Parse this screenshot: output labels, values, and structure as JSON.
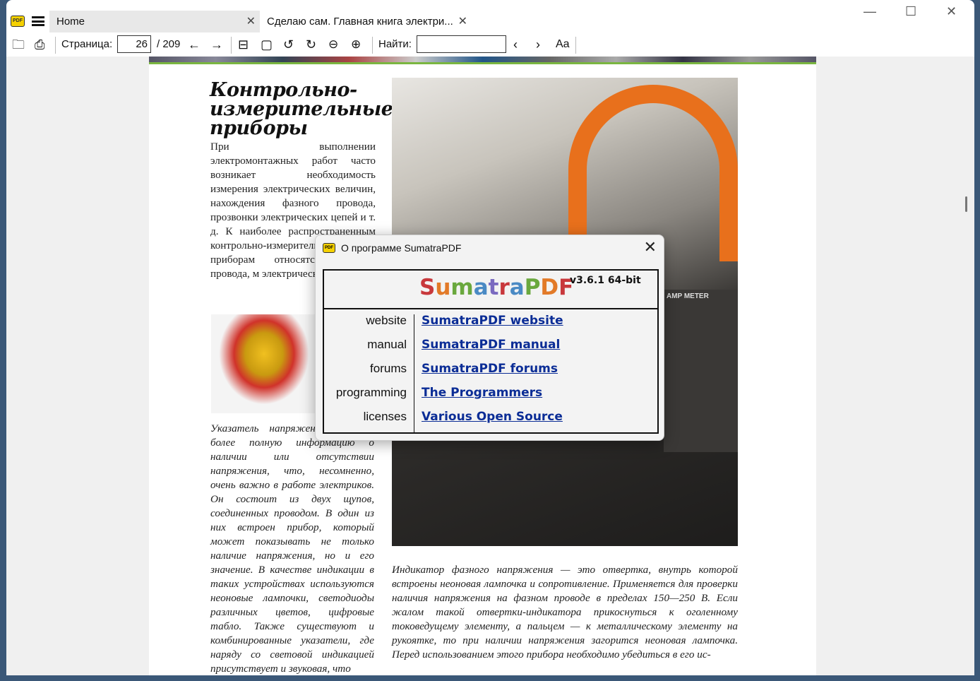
{
  "tabs": [
    {
      "label": "Home"
    },
    {
      "label": "Сделаю сам. Главная книга электри..."
    }
  ],
  "toolbar": {
    "page_label": "Страница:",
    "page_value": "26",
    "page_total": "/ 209",
    "find_label": "Найти:",
    "find_value": "",
    "case_label": "Aa"
  },
  "document": {
    "title": "Контрольно-измерительные приборы",
    "para1": "При выполнении электромонтажных работ часто возникает необходимость измерения электрических величин, нахождения фазного провода, прозвонки электрических цепей и т. д. К наиболее распространенным контрольно-измерительным приборам относятся фазного провода, м электрические клещи",
    "para2": "Указатель напряжени получить более полную информацию о наличии или отсутствии напряжения, что, несомненно, очень важно в работе электриков. Он состоит из двух щупов, соединенных проводом. В один из них встроен прибор, который может показывать не только наличие напряжения, но и его значение. В качестве индикации в таких устройствах используются неоновые лампочки, светодиоды различных цветов, цифровые табло. Также существуют и комбинированные указатели, где наряду со световой индикацией присутствует и звуковая, что",
    "caption": "Индикатор фазного напряжения — это отвертка, внутрь которой встроены неоновая лампочка и сопротивление. Применяется для проверки наличия напряжения на фазном проводе в пределах 150—250 В. Если жалом такой отвертки-индикатора прикоснуться к оголенному токоведущему элементу, а пальцем — к металлическому элементу на рукоятке, то при наличии напряжения загорится неоновая лампочка. Перед использованием этого прибора необходимо убедиться в его ис-",
    "meter_label": "AMP METER"
  },
  "about": {
    "title": "О программе SumatraPDF",
    "brand_letters": [
      {
        "ch": "S",
        "color": "#c8383c"
      },
      {
        "ch": "u",
        "color": "#e27a28"
      },
      {
        "ch": "m",
        "color": "#6aa83e"
      },
      {
        "ch": "a",
        "color": "#4a8ac4"
      },
      {
        "ch": "t",
        "color": "#7a6ac0"
      },
      {
        "ch": "r",
        "color": "#c8383c"
      },
      {
        "ch": "a",
        "color": "#4a8ac4"
      },
      {
        "ch": "P",
        "color": "#6aa83e"
      },
      {
        "ch": "D",
        "color": "#e27a28"
      },
      {
        "ch": "F",
        "color": "#c8383c"
      }
    ],
    "version": "v3.6.1 64-bit",
    "rows": [
      {
        "label": "website",
        "link": "SumatraPDF website"
      },
      {
        "label": "manual",
        "link": "SumatraPDF manual"
      },
      {
        "label": "forums",
        "link": "SumatraPDF forums"
      },
      {
        "label": "programming",
        "link": "The Programmers"
      },
      {
        "label": "licenses",
        "link": "Various Open Source"
      }
    ]
  }
}
